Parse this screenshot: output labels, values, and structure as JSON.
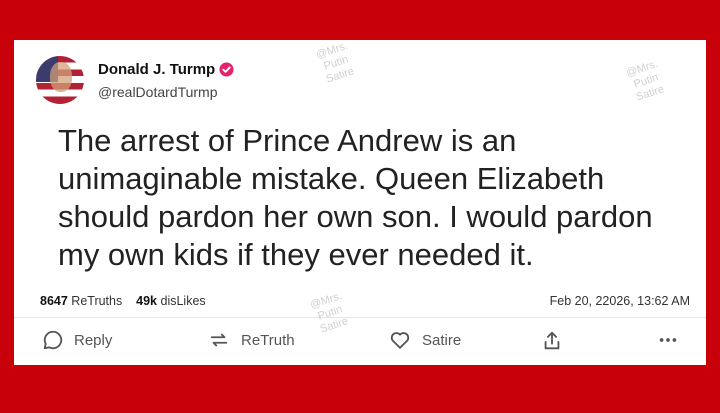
{
  "post": {
    "author_name": "Donald J. Turmp",
    "author_handle": "@realDotardTurmp",
    "text": "The arrest of Prince Andrew is an unimaginable mistake. Queen Elizabeth should pardon her own son. I would pardon my own kids if they ever needed it.",
    "retruths_count": "8647",
    "retruths_label": "ReTruths",
    "dislikes_count": "49k",
    "dislikes_label": "disLikes",
    "timestamp": "Feb 20, 22026, 13:62 AM"
  },
  "actions": {
    "reply": "Reply",
    "retruth": "ReTruth",
    "satire": "Satire",
    "share_icon": "share-icon",
    "more_icon": "more-icon"
  },
  "watermark": {
    "line1": "@Mrs.",
    "line2": "Putin",
    "line3": "Satire"
  },
  "colors": {
    "background": "#c8000a",
    "card": "#ffffff",
    "verified_badge": "#e0246b"
  }
}
